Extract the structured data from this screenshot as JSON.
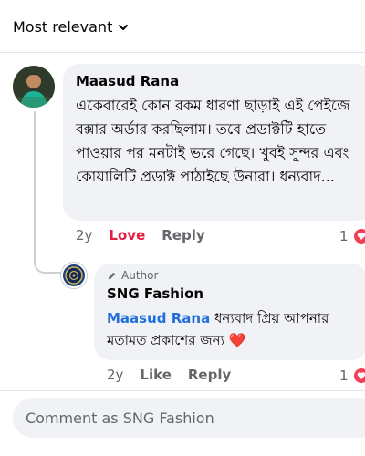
{
  "sort": {
    "label": "Most relevant",
    "icon": "chevron-down-icon"
  },
  "comment": {
    "author": "Maasud Rana",
    "text": "একেবারেই কোন রকম ধারণা ছাড়াই এই পেইজে বক্সার অর্ডার করছিলাম। তবে প্রডাক্টটি হাতে পাওয়ার পর মনটাই ভরে গেছে। খুবই সুন্দর এবং কোয়ালিটি প্রডাক্ট পাঠাইছে উনারা। ধন্যবাদ...",
    "time": "2y",
    "reaction_label": "Love",
    "reply_label": "Reply",
    "reaction_count": "1"
  },
  "reply": {
    "badge": "Author",
    "author": "SNG Fashion",
    "mention": "Maasud Rana",
    "text": " ধন্যবাদ প্রিয় আপনার মতামত প্রকাশের জন্য ",
    "emoji": "❤️",
    "time": "2y",
    "like_label": "Like",
    "reply_label": "Reply",
    "reaction_count": "1"
  },
  "composer": {
    "placeholder": "Comment as SNG Fashion"
  },
  "colors": {
    "love": "#e41e3f",
    "mention": "#216fdb",
    "bubble": "#f0f2f5"
  }
}
